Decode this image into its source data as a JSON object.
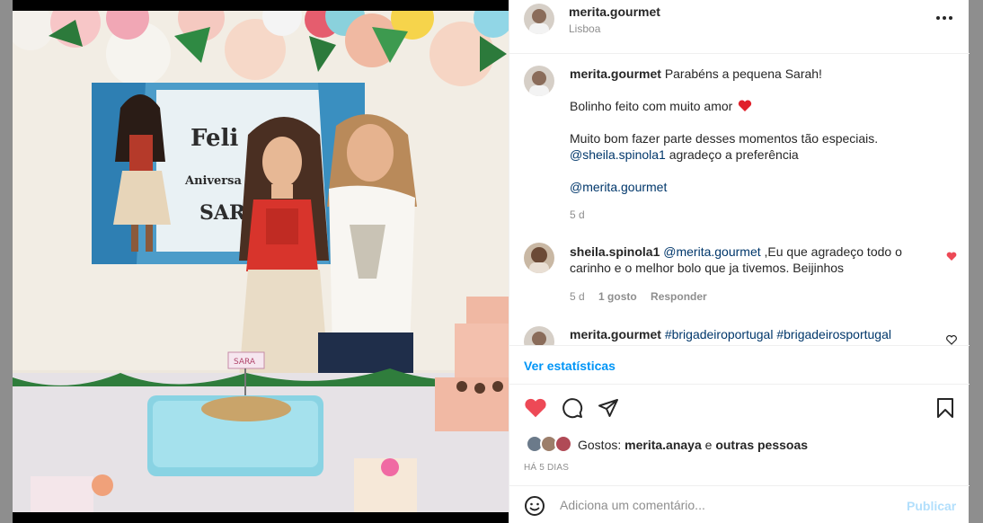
{
  "post": {
    "author": "merita.gourmet",
    "location": "Lisboa",
    "caption": {
      "line1": "Parabéns a pequena Sarah!",
      "line2": "Bolinho feito com muito amor",
      "line3": "Muito bom fazer parte desses momentos tão especiais.",
      "mention": "@sheila.spinola1",
      "line4_rest": " agradeço a preferência",
      "mention2": "@merita.gourmet",
      "time": "5 d"
    },
    "photo_text": {
      "banner_title": "Feli",
      "banner_sub": "Aniversa",
      "banner_name": "SAR",
      "cake_topper": "SARA"
    }
  },
  "comments": [
    {
      "author": "sheila.spinola1",
      "mention": "@merita.gourmet",
      "text_line1": " ,Eu que agradeço todo o",
      "text_line2": "carinho e o melhor bolo que ja tivemos. Beijinhos",
      "time": "5 d",
      "likes": "1 gosto",
      "reply": "Responder",
      "liked": true
    },
    {
      "author": "merita.gourmet",
      "hashtags": "#brigadeiroportugal #brigadeirosportugal"
    }
  ],
  "actions": {
    "insights": "Ver estatísticas",
    "likes_prefix": "Gostos: ",
    "likes_user": "merita.anaya",
    "likes_suffix": " e ",
    "likes_others": "outras pessoas",
    "date": "HÁ 5 DIAS"
  },
  "composer": {
    "placeholder": "Adiciona um comentário...",
    "publish": "Publicar"
  },
  "icons": {
    "more": "more-horizontal-icon",
    "like": "heart-icon",
    "comment": "comment-icon",
    "share": "paper-plane-icon",
    "save": "bookmark-icon",
    "emoji": "smiley-icon"
  },
  "colors": {
    "liked": "#ed4956",
    "link": "#00376b",
    "insights": "#0095f6",
    "publish_disabled": "#b2dffc"
  }
}
